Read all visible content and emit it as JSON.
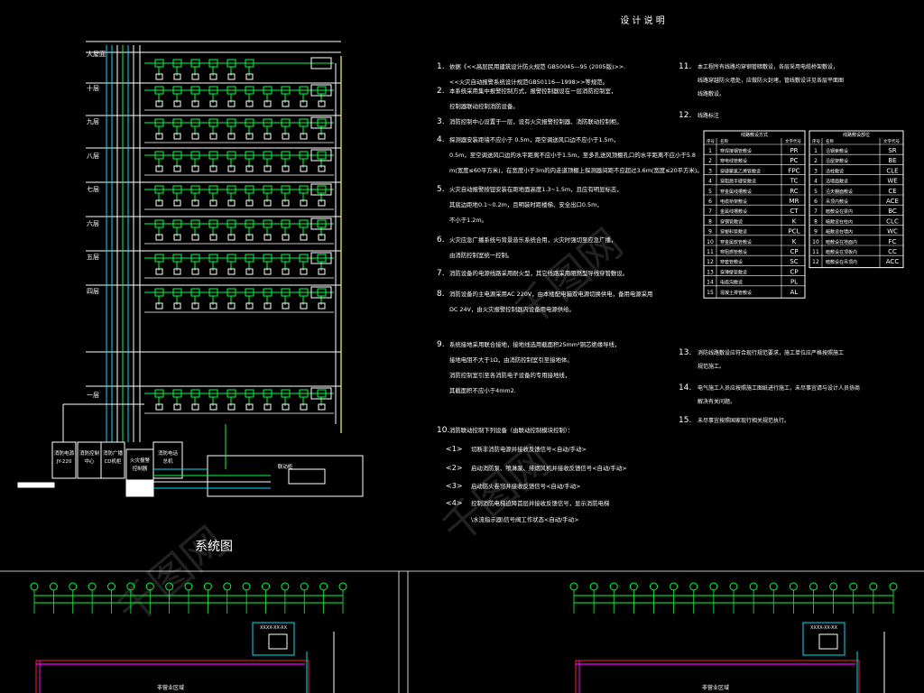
{
  "watermark": "千图网",
  "system_diagram": {
    "title": "系统图",
    "floors": [
      "大屋面",
      "十层",
      "九层",
      "八层",
      "七层",
      "六层",
      "五层",
      "四层",
      "一层"
    ],
    "equipment": [
      {
        "id": "e1",
        "label": "消防电源\nJY-220"
      },
      {
        "id": "e2",
        "label": "消防控制\n中心"
      },
      {
        "id": "e3",
        "label": "消防广播\nCD机柜"
      },
      {
        "id": "e4",
        "label": "火灾报警\n控制器"
      },
      {
        "id": "e5",
        "label": "消防电话\n总机"
      },
      {
        "id": "e6",
        "label": "联动柜"
      }
    ]
  },
  "notes": {
    "title": "设 计 说 明",
    "items": [
      {
        "num": "1.",
        "lines": [
          "依据《<<高层民用建筑设计防火规范 GB50045—95 (2005版)>>.",
          "<<火灾自动报警系统设计规范GB50116—1998>>等规范。"
        ]
      },
      {
        "num": "2.",
        "lines": [
          "本系统采用集中报警控制方式，报警控制器设在一层消防控制室，",
          "控制器联动控制消防设备。"
        ]
      },
      {
        "num": "3.",
        "lines": [
          "消防控制中心设置于一层，设有火灾报警控制器、消防联动控制柜。"
        ]
      },
      {
        "num": "4.",
        "lines": [
          "探测器安装距墙不应小于 0.5m，距空调送风口边不应小于1.5m，",
          "0.5m，至空调送风口边的水平距离不应小于1.5m，至多孔送风顶棚孔口的水平距离不应小于5.8",
          "m(宽度≤60平方米)，在宽度小于3m的内走道顶棚上探测器间距不应超过3.6m(宽度≤20平方米)。"
        ]
      },
      {
        "num": "5.",
        "lines": [
          "火灾自动报警按钮安装在距地面高度1.3~1.5m，且应有明显标志，",
          "其底边距地0.1~0.2m，且明装时距楼梯、安全出口0.5m，",
          "不小于1.2m。"
        ]
      },
      {
        "num": "6.",
        "lines": [
          "火灾应急广播系统与背景音乐系统合用，火灾时强切至应急广播，",
          "由消防控制室统一控制。"
        ]
      },
      {
        "num": "7.",
        "lines": [
          "消防设备的电源线路采用耐火型，其它线路采用阻燃型导线穿管敷设。"
        ]
      },
      {
        "num": "8.",
        "lines": [
          "消防设备的主电源采用AC 220V，由本楼配电箱双电源切换供电，备用电源采用",
          "DC 24V，由火灾报警控制器内设备用电源供给。"
        ]
      },
      {
        "num": "9.",
        "lines": [
          "系统接地采用联合接地，接地线选用截面积25mm²铜芯绝缘导线，",
          "接地电阻不大于1Ω，由消防控制室引至接地体。",
          "消防控制室引至各消防电子设备的专用接地线，",
          "其截面积不应小于4mm2."
        ]
      },
      {
        "num": "10.",
        "lines": [
          "消防联动控制下列设备（由联动控制模块控制）："
        ]
      }
    ],
    "sub_items": [
      {
        "num": "<1>",
        "text": "切断非消防电源并接收反馈信号<自动/手动>"
      },
      {
        "num": "<2>",
        "text": "启动消防泵、喷淋泵、排烟风机并接收反馈信号<自动/手动>"
      },
      {
        "num": "<3>",
        "text": "启动防火卷帘并接收反馈信号<自动/手动>"
      },
      {
        "num": "<4>",
        "text": "控制消防电梯迫降首层并接收反馈信号，显示消防电梯"
      },
      {
        "num": "",
        "text": "\\水流指示器\\信号阀工作状态<自动/手动>"
      }
    ],
    "right_items": [
      {
        "num": "11.",
        "lines": [
          "本工程所有线路均穿钢管暗敷设，各层采用电缆桥架敷设，",
          "线路穿越防火墙处，应做防火封堵，管线敷设详见各层平面图",
          "线路敷设。"
        ]
      },
      {
        "num": "12.",
        "lines": [
          "线路标注"
        ]
      },
      {
        "num": "13.",
        "lines": [
          "消防线路敷设应符合现行规范要求，施工单位应严格按照施工",
          "规范施工。"
        ]
      },
      {
        "num": "14.",
        "lines": [
          "电气施工人员应按照施工图纸进行施工，未尽事宜请与设计人员协商",
          "解决有关问题。"
        ]
      },
      {
        "num": "15.",
        "lines": [
          "未尽事宜按照国家现行相关规范执行。"
        ]
      }
    ]
  },
  "legend_tables": {
    "left": {
      "header": "线路敷设方式",
      "col_labels": [
        "序号",
        "名称",
        "文字代号"
      ],
      "rows": [
        [
          "1",
          "穿焊接钢管敷设",
          "PR"
        ],
        [
          "2",
          "穿电线管敷设",
          "PC"
        ],
        [
          "3",
          "穿硬聚氯乙烯管敷设",
          "FPC"
        ],
        [
          "4",
          "穿阻燃半硬管敷设",
          "TC"
        ],
        [
          "5",
          "穿金属线槽敷设",
          "RC"
        ],
        [
          "6",
          "电缆桥架敷设",
          "MR"
        ],
        [
          "7",
          "金属线槽敷设",
          "CT"
        ],
        [
          "8",
          "穿钢管敷设",
          "K"
        ],
        [
          "9",
          "穿塑料管敷设",
          "PCL"
        ],
        [
          "10",
          "穿金属软管敷设",
          "K"
        ],
        [
          "11",
          "穿阻燃管敷设",
          "CP"
        ],
        [
          "12",
          "穿套管敷设",
          "SC"
        ],
        [
          "13",
          "穿薄壁管敷设",
          "CP"
        ],
        [
          "14",
          "电缆沟敷设",
          "PL"
        ],
        [
          "15",
          "混凝土排管敷设",
          "AL"
        ]
      ]
    },
    "right": {
      "header": "线路敷设部位",
      "col_labels": [
        "序号",
        "名称",
        "文字代号"
      ],
      "rows": [
        [
          "1",
          "沿钢索敷设",
          "SR"
        ],
        [
          "2",
          "沿屋架敷设",
          "BE"
        ],
        [
          "3",
          "沿柱敷设",
          "CLE"
        ],
        [
          "4",
          "沿墙面敷设",
          "WE"
        ],
        [
          "5",
          "沿天棚面敷设",
          "CE"
        ],
        [
          "6",
          "吊顶内敷设",
          "ACE"
        ],
        [
          "7",
          "暗敷设在梁内",
          "BC"
        ],
        [
          "8",
          "暗敷设在柱内",
          "CLC"
        ],
        [
          "9",
          "暗敷设在墙内",
          "WC"
        ],
        [
          "10",
          "暗敷设在地面内",
          "FC"
        ],
        [
          "11",
          "暗敷设在顶板内",
          "CC"
        ],
        [
          "12",
          "暗敷设在吊顶内",
          "ACC"
        ]
      ]
    }
  },
  "plans": {
    "left": {
      "area_label": "非营业区域",
      "box_label": "XXXX-XX-XX"
    },
    "right": {
      "area_label": "非营业区域",
      "box_label": "XXXX-XX-XX"
    }
  },
  "colors": {
    "white": "#ffffff",
    "green": "#00ff3c",
    "cyan": "#00e0ff",
    "yellow": "#ffff40",
    "magenta": "#ff00ff",
    "red": "#ff2020"
  }
}
